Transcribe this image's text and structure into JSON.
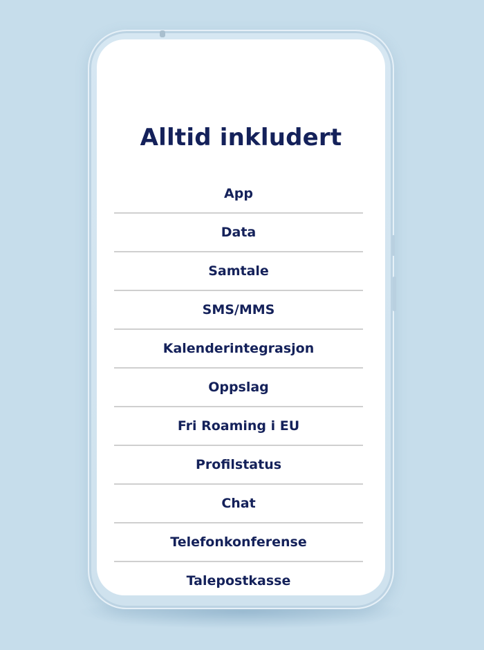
{
  "card": {
    "title": "Alltid inkludert"
  },
  "features": [
    "App",
    "Data",
    "Samtale",
    "SMS/MMS",
    "Kalenderintegrasjon",
    "Oppslag",
    "Fri Roaming i EU",
    "Profilstatus",
    "Chat",
    "Telefonkonferense",
    "Talepostkasse"
  ],
  "colors": {
    "background": "#c6ddeb",
    "text": "#14215a",
    "divider": "#cfcfcf",
    "screen": "#ffffff"
  }
}
